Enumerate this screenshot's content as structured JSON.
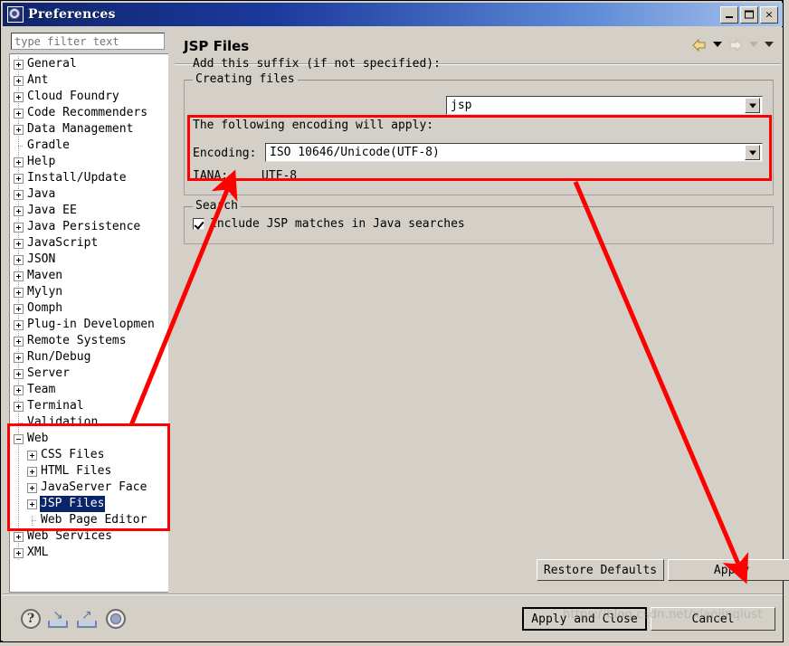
{
  "window": {
    "title": "Preferences",
    "icon": "preferences-gear-icon",
    "controls": {
      "minimize": "minimize-button",
      "maximize": "maximize-button",
      "close": "×"
    }
  },
  "sidebar": {
    "filter": {
      "value": "",
      "placeholder": "type filter text"
    },
    "items": [
      {
        "label": "General",
        "expander": "plus",
        "indent": 0,
        "selected": false
      },
      {
        "label": "Ant",
        "expander": "plus",
        "indent": 0,
        "selected": false
      },
      {
        "label": "Cloud Foundry",
        "expander": "plus",
        "indent": 0,
        "selected": false
      },
      {
        "label": "Code Recommenders",
        "expander": "plus",
        "indent": 0,
        "selected": false
      },
      {
        "label": "Data Management",
        "expander": "plus",
        "indent": 0,
        "selected": false
      },
      {
        "label": "Gradle",
        "expander": "leaf",
        "indent": 0,
        "selected": false
      },
      {
        "label": "Help",
        "expander": "plus",
        "indent": 0,
        "selected": false
      },
      {
        "label": "Install/Update",
        "expander": "plus",
        "indent": 0,
        "selected": false
      },
      {
        "label": "Java",
        "expander": "plus",
        "indent": 0,
        "selected": false
      },
      {
        "label": "Java EE",
        "expander": "plus",
        "indent": 0,
        "selected": false
      },
      {
        "label": "Java Persistence",
        "expander": "plus",
        "indent": 0,
        "selected": false
      },
      {
        "label": "JavaScript",
        "expander": "plus",
        "indent": 0,
        "selected": false
      },
      {
        "label": "JSON",
        "expander": "plus",
        "indent": 0,
        "selected": false
      },
      {
        "label": "Maven",
        "expander": "plus",
        "indent": 0,
        "selected": false
      },
      {
        "label": "Mylyn",
        "expander": "plus",
        "indent": 0,
        "selected": false
      },
      {
        "label": "Oomph",
        "expander": "plus",
        "indent": 0,
        "selected": false
      },
      {
        "label": "Plug-in Developmen",
        "expander": "plus",
        "indent": 0,
        "selected": false
      },
      {
        "label": "Remote Systems",
        "expander": "plus",
        "indent": 0,
        "selected": false
      },
      {
        "label": "Run/Debug",
        "expander": "plus",
        "indent": 0,
        "selected": false
      },
      {
        "label": "Server",
        "expander": "plus",
        "indent": 0,
        "selected": false
      },
      {
        "label": "Team",
        "expander": "plus",
        "indent": 0,
        "selected": false
      },
      {
        "label": "Terminal",
        "expander": "plus",
        "indent": 0,
        "selected": false
      },
      {
        "label": "Validation",
        "expander": "leaf",
        "indent": 0,
        "selected": false
      },
      {
        "label": "Web",
        "expander": "minus",
        "indent": 0,
        "selected": false
      },
      {
        "label": "CSS Files",
        "expander": "plus",
        "indent": 1,
        "selected": false
      },
      {
        "label": "HTML Files",
        "expander": "plus",
        "indent": 1,
        "selected": false
      },
      {
        "label": "JavaServer Face",
        "expander": "plus",
        "indent": 1,
        "selected": false
      },
      {
        "label": "JSP Files",
        "expander": "plus",
        "indent": 1,
        "selected": true
      },
      {
        "label": "Web Page Editor",
        "expander": "leaf",
        "indent": 1,
        "selected": false
      },
      {
        "label": "Web Services",
        "expander": "plus",
        "indent": 0,
        "selected": false
      },
      {
        "label": "XML",
        "expander": "plus",
        "indent": 0,
        "selected": false
      }
    ],
    "hscroll": {
      "left_arrow": "◄",
      "right_arrow": "►"
    }
  },
  "page": {
    "title": "JSP Files",
    "nav": {
      "back_icon": "back-arrow-icon",
      "back_menu_icon": "chevron-down-icon",
      "forward_icon": "forward-arrow-icon",
      "forward_menu_icon": "chevron-down-icon",
      "view_menu_icon": "chevron-down-icon"
    },
    "creating_files": {
      "legend": "Creating files",
      "suffix_label": "Add this suffix (if not specified):",
      "suffix_value": "jsp",
      "encoding_note": "The following encoding will apply:",
      "encoding_label": "Encoding:",
      "encoding_value": "ISO 10646/Unicode(UTF-8)",
      "iana_label": "IANA:",
      "iana_value": "UTF-8"
    },
    "search": {
      "legend": "Search",
      "checkbox_label": "Include JSP matches in Java searches",
      "checkbox_checked": true
    },
    "buttons": {
      "restore_defaults": "Restore Defaults",
      "apply": "Apply"
    }
  },
  "footer": {
    "icons": {
      "help": "?",
      "import": "import-preferences-icon",
      "export": "export-preferences-icon",
      "oomph": "oomph-record-icon"
    },
    "buttons": {
      "apply_and_close": "Apply and Close",
      "cancel": "Cancel"
    },
    "watermark": "https://blog.csdn.net/xiaojinqiust"
  },
  "annotations": {
    "color": "#ff0000",
    "box_encoding": "highlight-encoding-group",
    "box_webtree": "highlight-web-tree",
    "arrow_tree_to_encoding": "arrow-from-web-tree-to-encoding",
    "arrow_encoding_to_apply": "arrow-from-encoding-to-apply-button"
  }
}
